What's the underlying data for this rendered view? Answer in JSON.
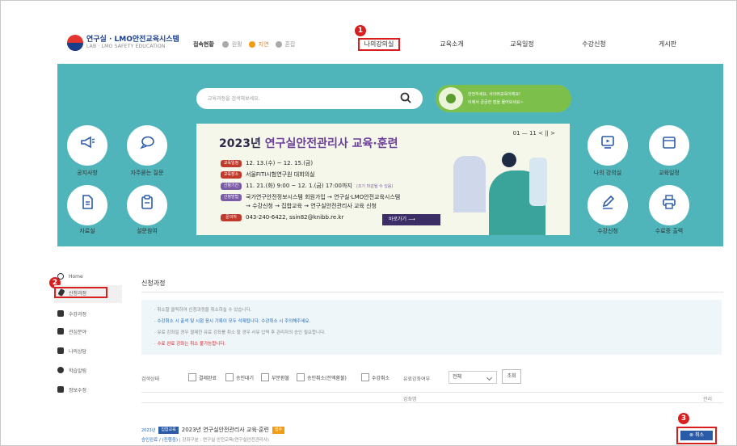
{
  "header": {
    "logo_title": "연구실 · LMO안전교육시스템",
    "logo_subtitle": "LAB · LMO SAFETY EDUCATION",
    "status_label": "접속현황",
    "status_items": [
      "원활",
      "지연",
      "혼잡"
    ],
    "nav": [
      "나의강의실",
      "교육소개",
      "교육일정",
      "수강신청",
      "게시판"
    ]
  },
  "badges": [
    "1",
    "2",
    "3"
  ],
  "banner": {
    "search_placeholder": "교육과정을 검색해보세요.",
    "promo_line1": "안전하세요, 사이버교육이에요!",
    "promo_line2": "이제서 궁금한 점을 물어보세요~",
    "left_buttons": [
      "공지사항",
      "자주묻는 질문",
      "자료실",
      "설문참여"
    ],
    "right_buttons": [
      "나의 강의실",
      "교육일정",
      "수강신청",
      "수료증 출력"
    ],
    "slide": {
      "title_plain": "2023년 ",
      "title_highlight": "연구실안전관리사 교육·훈련",
      "pager": "01 — 11   <  ||  >",
      "rows": [
        {
          "tag": "교육일정",
          "text": "12. 13.(수) ~ 12. 15.(금)"
        },
        {
          "tag": "교육장소",
          "text": "서울FITI시험연구원 대회의실"
        },
        {
          "tag": "신청기간",
          "text": "11. 21.(화) 9:00 ~ 12. 1.(금) 17:00까지",
          "note": "(조기 마감될 수 있음)"
        },
        {
          "tag": "신청방법",
          "text": "국가연구안전정보시스템 회원가입 → 연구실·LMO안전교육시스템"
        },
        {
          "tag": "",
          "text": "→ 수강신청 → 집합교육 → 연구실안전관리사 교육 신청"
        },
        {
          "tag": "문의처",
          "text": "043-240-6422, ssin82@knibb.re.kr"
        }
      ],
      "go_label": "바로가기 ⟶"
    }
  },
  "sidebar": {
    "items": [
      "Home",
      "신청과정",
      "수강과정",
      "관심분야",
      "나의상담",
      "학습알림",
      "정보수정"
    ]
  },
  "content": {
    "page_title": "신청과정",
    "notices": [
      "· 취소할 클릭하여 신청과정을 취소하실 수 있습니다.",
      "· 수강취소 시 출석 및 시험 응시 기록이 모두 삭제됩니다. 수강취소 시 주의해주세요.",
      "· 유료 강좌일 경우 결제한 유료 강좌를 취소 할 경우 사유 입력 후 관리자의 승인 필요합니다.",
      "· 수료 완료 강좌는 취소 불가능합니다."
    ],
    "filter_label": "검색상태",
    "checkboxes": [
      "결제완료",
      "승인대기",
      "부분환불",
      "승인취소(전액환불)",
      "수강취소"
    ],
    "select_label": "유료강좌여부",
    "select_value": "전체",
    "query_button": "조회",
    "columns": [
      "강좌명",
      "관리"
    ],
    "row": {
      "year": "2023년",
      "category": "집합교육",
      "title": "2023년 연구실안전관리사 교육·훈련",
      "status": "접수",
      "sub_status": "승인완료 / (진행중)",
      "sub_detail": "강좌구분 : 연구실 안전교육(연구실안전관리사)",
      "cancel_label": "취소"
    }
  },
  "colors": {
    "banner": "#4fb5ba",
    "accent_red": "#d81e1e",
    "brand_blue": "#1a3e8a",
    "button_blue": "#2a5ba8"
  }
}
